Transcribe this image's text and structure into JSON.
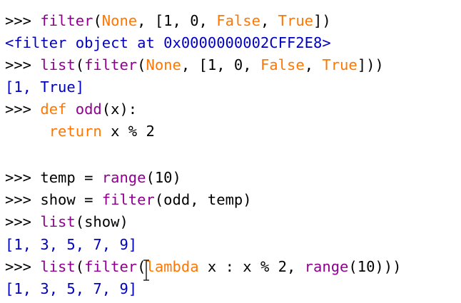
{
  "shell": {
    "lines": [
      {
        "parts": [
          {
            "c": "prompt",
            "t": ">>> "
          },
          {
            "c": "bi",
            "t": "filter"
          },
          {
            "c": "",
            "t": "("
          },
          {
            "c": "kw",
            "t": "None"
          },
          {
            "c": "",
            "t": ", [1, 0, "
          },
          {
            "c": "kw",
            "t": "False"
          },
          {
            "c": "",
            "t": ", "
          },
          {
            "c": "kw",
            "t": "True"
          },
          {
            "c": "",
            "t": "])"
          }
        ]
      },
      {
        "parts": [
          {
            "c": "out",
            "t": "<filter object at 0x0000000002CFF2E8>"
          }
        ]
      },
      {
        "parts": [
          {
            "c": "prompt",
            "t": ">>> "
          },
          {
            "c": "bi",
            "t": "list"
          },
          {
            "c": "",
            "t": "("
          },
          {
            "c": "bi",
            "t": "filter"
          },
          {
            "c": "",
            "t": "("
          },
          {
            "c": "kw",
            "t": "None"
          },
          {
            "c": "",
            "t": ", [1, 0, "
          },
          {
            "c": "kw",
            "t": "False"
          },
          {
            "c": "",
            "t": ", "
          },
          {
            "c": "kw",
            "t": "True"
          },
          {
            "c": "",
            "t": "]))"
          }
        ]
      },
      {
        "parts": [
          {
            "c": "out",
            "t": "[1, True]"
          }
        ]
      },
      {
        "parts": [
          {
            "c": "prompt",
            "t": ">>> "
          },
          {
            "c": "kw",
            "t": "def"
          },
          {
            "c": "",
            "t": " "
          },
          {
            "c": "bi",
            "t": "odd"
          },
          {
            "c": "",
            "t": "(x):"
          }
        ]
      },
      {
        "parts": [
          {
            "c": "",
            "t": "     "
          },
          {
            "c": "kw",
            "t": "return"
          },
          {
            "c": "",
            "t": " x % 2"
          }
        ]
      },
      {
        "parts": [
          {
            "c": "",
            "t": ""
          }
        ]
      },
      {
        "parts": [
          {
            "c": "",
            "t": ""
          }
        ]
      },
      {
        "parts": [
          {
            "c": "prompt",
            "t": ">>> "
          },
          {
            "c": "",
            "t": "temp = "
          },
          {
            "c": "bi",
            "t": "range"
          },
          {
            "c": "",
            "t": "(10)"
          }
        ]
      },
      {
        "parts": [
          {
            "c": "prompt",
            "t": ">>> "
          },
          {
            "c": "",
            "t": "show = "
          },
          {
            "c": "bi",
            "t": "filter"
          },
          {
            "c": "",
            "t": "(odd, temp)"
          }
        ]
      },
      {
        "parts": [
          {
            "c": "prompt",
            "t": ">>> "
          },
          {
            "c": "bi",
            "t": "list"
          },
          {
            "c": "",
            "t": "(show)"
          }
        ]
      },
      {
        "parts": [
          {
            "c": "out",
            "t": "[1, 3, 5, 7, 9]"
          }
        ]
      },
      {
        "parts": [
          {
            "c": "prompt",
            "t": ">>> "
          },
          {
            "c": "bi",
            "t": "list"
          },
          {
            "c": "",
            "t": "("
          },
          {
            "c": "bi",
            "t": "filter"
          },
          {
            "c": "",
            "t": "("
          },
          {
            "c": "kw",
            "t": "lambda"
          },
          {
            "c": "",
            "t": " x : x % 2, "
          },
          {
            "c": "bi",
            "t": "range"
          },
          {
            "c": "",
            "t": "(10)))"
          }
        ]
      },
      {
        "parts": [
          {
            "c": "out",
            "t": "[1, 3, 5, 7, 9]"
          }
        ]
      }
    ]
  },
  "colors": {
    "keyword": "#ff7700",
    "builtin": "#900090",
    "output": "#0000c0",
    "text": "#000000",
    "background": "#ffffff"
  },
  "icons": {
    "text_cursor": "i-beam-icon"
  }
}
